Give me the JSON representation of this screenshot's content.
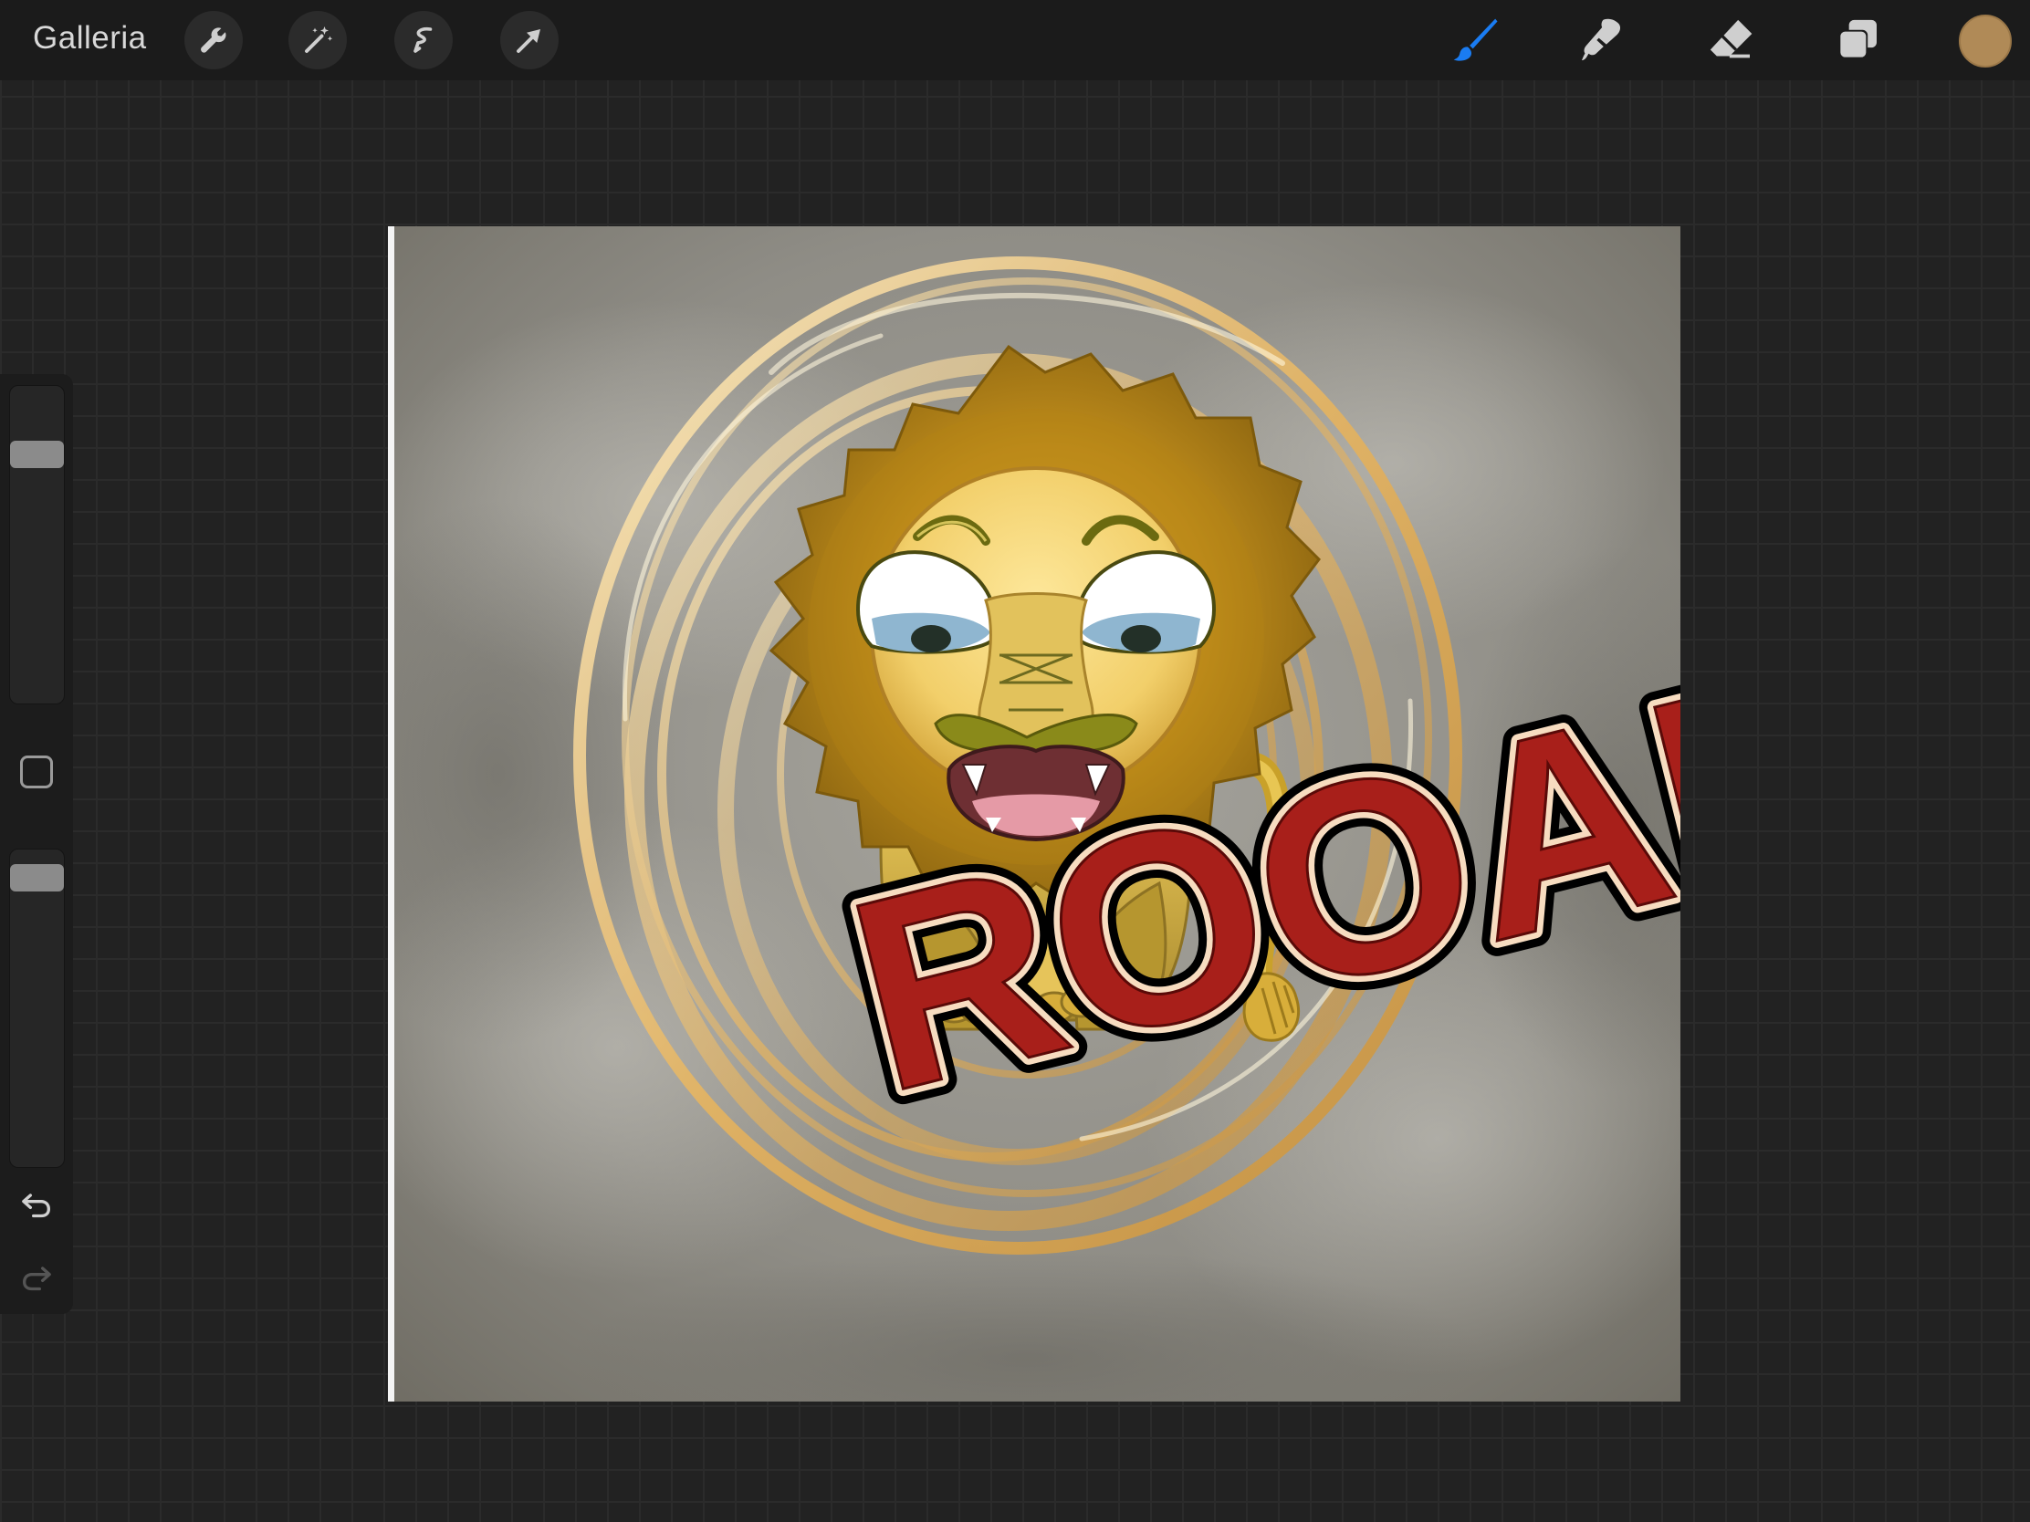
{
  "toolbar": {
    "gallery_label": "Galleria",
    "left_tools": [
      {
        "name": "wrench-icon",
        "label": "Actions"
      },
      {
        "name": "magic-wand-icon",
        "label": "Adjustments"
      },
      {
        "name": "selection-icon",
        "label": "Selection"
      },
      {
        "name": "transform-arrow-icon",
        "label": "Transform"
      }
    ],
    "right_tools": [
      {
        "name": "brush-icon",
        "active": true
      },
      {
        "name": "smudge-icon",
        "active": false
      },
      {
        "name": "eraser-icon",
        "active": false
      },
      {
        "name": "layers-icon",
        "active": false
      }
    ],
    "current_color": "#b08a57",
    "active_color": "#1a7cf2"
  },
  "sidebar": {
    "brush_size_level": 0.2,
    "opacity_level": 0.05,
    "icons": [
      "modify-square-icon",
      "undo-icon",
      "redo-icon"
    ]
  },
  "canvas": {
    "artwork_text": "ROOAR!"
  }
}
